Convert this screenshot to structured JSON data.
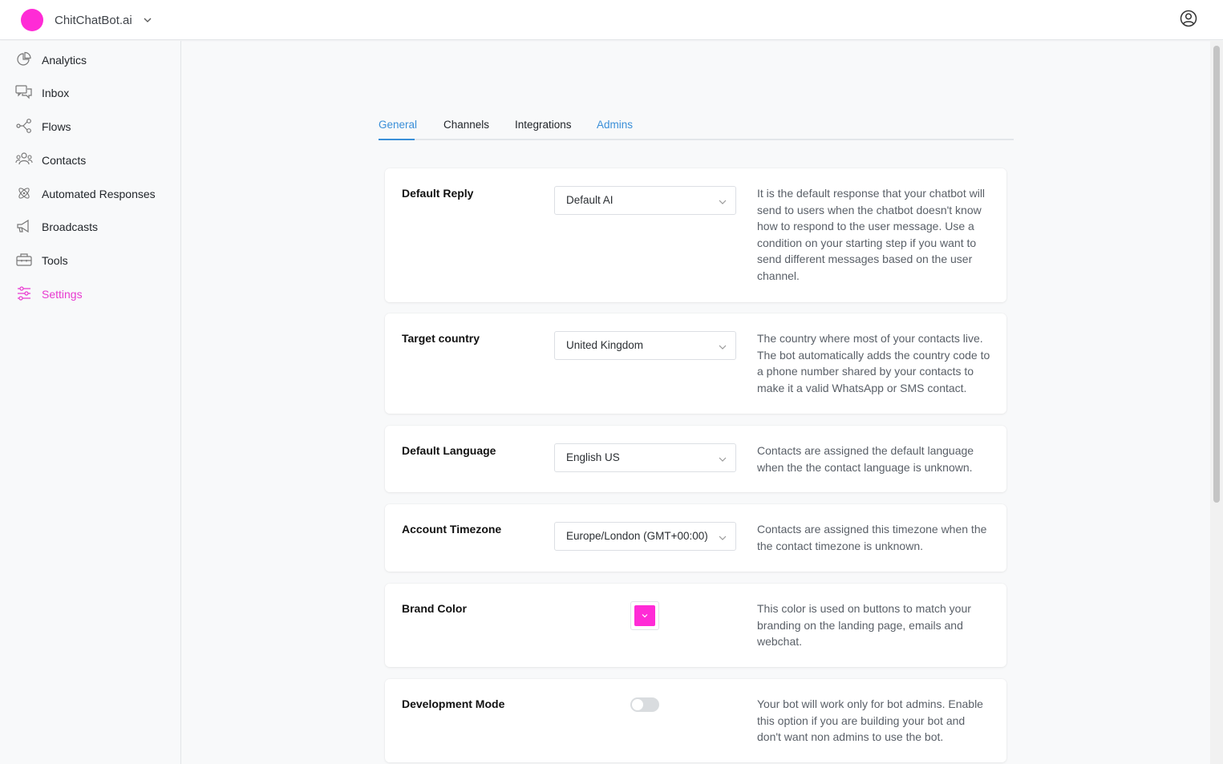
{
  "header": {
    "brand_name": "ChitChatBot.ai",
    "brand_color": "#ff2bd6",
    "brand_menu_icon": "chevron-down-icon",
    "user_icon": "user-circle-icon"
  },
  "sidebar": {
    "active_color": "#e83ad0",
    "items": [
      {
        "label": "Analytics",
        "icon": "pie-chart-icon"
      },
      {
        "label": "Inbox",
        "icon": "chat-bubbles-icon"
      },
      {
        "label": "Flows",
        "icon": "flow-nodes-icon"
      },
      {
        "label": "Contacts",
        "icon": "people-icon"
      },
      {
        "label": "Automated Responses",
        "icon": "atom-icon"
      },
      {
        "label": "Broadcasts",
        "icon": "megaphone-icon"
      },
      {
        "label": "Tools",
        "icon": "toolbox-icon"
      },
      {
        "label": "Settings",
        "icon": "sliders-icon",
        "active": true
      }
    ]
  },
  "tabs": [
    {
      "label": "General",
      "active": true
    },
    {
      "label": "Channels"
    },
    {
      "label": "Integrations"
    },
    {
      "label": "Admins"
    }
  ],
  "settings": {
    "default_reply": {
      "title": "Default Reply",
      "value": "Default AI",
      "description": "It is the default response that your chatbot will send to users when the chatbot doesn't know how to respond to the user message. Use a condition on your starting step if you want to send different messages based on the user channel."
    },
    "target_country": {
      "title": "Target country",
      "value": "United Kingdom",
      "description": "The country where most of your contacts live. The bot automatically adds the country code to a phone number shared by your contacts to make it a valid WhatsApp or SMS contact."
    },
    "default_language": {
      "title": "Default Language",
      "value": "English US",
      "description": "Contacts are assigned the default language when the the contact language is unknown."
    },
    "account_timezone": {
      "title": "Account Timezone",
      "value": "Europe/London (GMT+00:00)",
      "description": "Contacts are assigned this timezone when the the contact timezone is unknown."
    },
    "brand_color": {
      "title": "Brand Color",
      "color": "#ff2bd6",
      "description": "This color is used on buttons to match your branding on the landing page, emails and webchat."
    },
    "development_mode": {
      "title": "Development Mode",
      "enabled": false,
      "description": "Your bot will work only for bot admins. Enable this option if you are building your bot and don't want non admins to use the bot."
    }
  }
}
